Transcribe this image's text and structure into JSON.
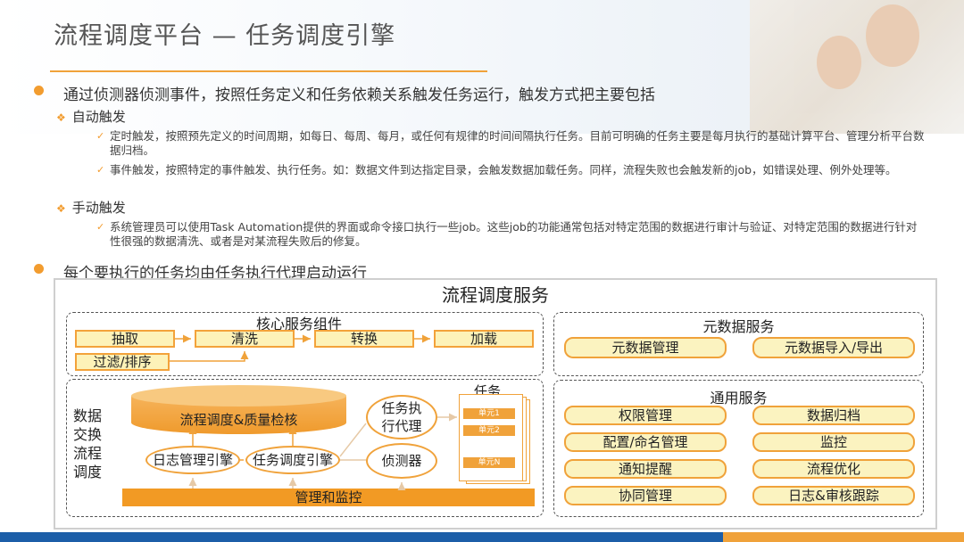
{
  "title": "流程调度平台 — 任务调度引擎",
  "bullets": [
    {
      "text": "通过侦测器侦测事件，按照任务定义和任务依赖关系触发任务运行，触发方式把主要包括",
      "subs": [
        {
          "label": "自动触发",
          "items": [
            "定时触发，按照预先定义的时间周期，如每日、每周、每月，或任何有规律的时间间隔执行任务。目前可明确的任务主要是每月执行的基础计算平台、管理分析平台数据归档。",
            "事件触发，按照特定的事件触发、执行任务。如：数据文件到达指定目录，会触发数据加载任务。同样，流程失败也会触发新的job，如错误处理、例外处理等。"
          ]
        },
        {
          "label": "手动触发",
          "items": [
            "系统管理员可以使用Task Automation提供的界面或命令接口执行一些job。这些job的功能通常包括对特定范围的数据进行审计与验证、对特定范围的数据进行针对性很强的数据清洗、或者是对某流程失败后的修复。"
          ]
        }
      ]
    },
    {
      "text": "每个要执行的任务均由任务执行代理启动运行"
    }
  ],
  "diagram": {
    "title": "流程调度服务",
    "core": {
      "title": "核心服务组件",
      "steps": [
        "抽取",
        "清洗",
        "转换",
        "加载"
      ],
      "filter": "过滤/排序"
    },
    "exchange": {
      "side_label": "数据交换流程调度",
      "cylinder": "流程调度&质量检核",
      "log_engine": "日志管理引擎",
      "task_engine": "任务调度引擎",
      "agent": "任务执行代理",
      "detector": "侦测器",
      "tasks_title": "任务",
      "units": [
        "单元1",
        "单元2",
        "单元N"
      ],
      "management": "管理和监控"
    },
    "metadata": {
      "title": "元数据服务",
      "items": [
        "元数据管理",
        "元数据导入/导出"
      ]
    },
    "common": {
      "title": "通用服务",
      "items": [
        "权限管理",
        "数据归档",
        "配置/命名管理",
        "监控",
        "通知提醒",
        "流程优化",
        "协同管理",
        "日志&审核跟踪"
      ]
    }
  },
  "colors": {
    "accent": "#f0a23a",
    "fill": "#fdf2b8",
    "bar": "#f29a24",
    "blue": "#1c5ea8"
  }
}
